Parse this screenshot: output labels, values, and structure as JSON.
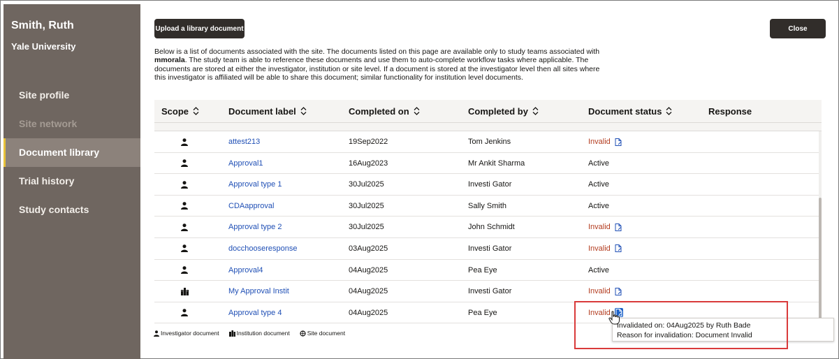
{
  "sidebar": {
    "user_name": "Smith, Ruth",
    "org_name": "Yale University",
    "items": [
      {
        "label": "Site profile",
        "state": "normal"
      },
      {
        "label": "Site network",
        "state": "disabled"
      },
      {
        "label": "Document library",
        "state": "active"
      },
      {
        "label": "Trial history",
        "state": "normal"
      },
      {
        "label": "Study contacts",
        "state": "normal"
      }
    ]
  },
  "toolbar": {
    "upload_label": "Upload a library document",
    "close_label": "Close"
  },
  "intro": {
    "part1": "Below is a list of documents associated with the site. The documents listed on this page are available only to study teams associated with",
    "username": "mmorala",
    "part2": ". The study team is able to reference these documents and use them to auto-complete workflow tasks where applicable. The documents are stored at either the investigator, institution or site level. If a document is stored at the investigator level then all sites where this investigator is affiliated will be able to share this document; similar functionality for institution level documents."
  },
  "table": {
    "columns": [
      "Scope",
      "Document label",
      "Completed on",
      "Completed by",
      "Document status",
      "Response"
    ],
    "rows": [
      {
        "scope": "investigator",
        "label": "attest213",
        "completed_on": "19Sep2022",
        "completed_by": "Tom Jenkins",
        "status": "Invalid"
      },
      {
        "scope": "investigator",
        "label": "Approval1",
        "completed_on": "16Aug2023",
        "completed_by": "Mr Ankit Sharma",
        "status": "Active"
      },
      {
        "scope": "investigator",
        "label": "Approval type 1",
        "completed_on": "30Jul2025",
        "completed_by": "Investi Gator",
        "status": "Active"
      },
      {
        "scope": "investigator",
        "label": "CDAapproval",
        "completed_on": "30Jul2025",
        "completed_by": "Sally Smith",
        "status": "Active"
      },
      {
        "scope": "investigator",
        "label": "Approval type 2",
        "completed_on": "30Jul2025",
        "completed_by": "John Schmidt",
        "status": "Invalid"
      },
      {
        "scope": "investigator",
        "label": "docchooseresponse",
        "completed_on": "03Aug2025",
        "completed_by": "Investi Gator",
        "status": "Invalid"
      },
      {
        "scope": "investigator",
        "label": "Approval4",
        "completed_on": "04Aug2025",
        "completed_by": "Pea Eye",
        "status": "Active"
      },
      {
        "scope": "institution",
        "label": "My Approval Instit",
        "completed_on": "04Aug2025",
        "completed_by": "Investi Gator",
        "status": "Invalid"
      },
      {
        "scope": "investigator",
        "label": "Approval type 4",
        "completed_on": "04Aug2025",
        "completed_by": "Pea Eye",
        "status": "Invalid"
      }
    ]
  },
  "legend": {
    "investigator": "Investigator document",
    "institution": "Institution document",
    "site": "Site document"
  },
  "tooltip": {
    "line1": "Invalidated on: 04Aug2025 by Ruth Bade",
    "line2": "Reason for invalidation: Document Invalid"
  },
  "colors": {
    "sidebar_bg": "#6f6660",
    "active_nav_bg": "#8c827b",
    "link": "#1f4fb5",
    "invalid": "#b33c1f",
    "highlight_border": "#d93a3a"
  }
}
